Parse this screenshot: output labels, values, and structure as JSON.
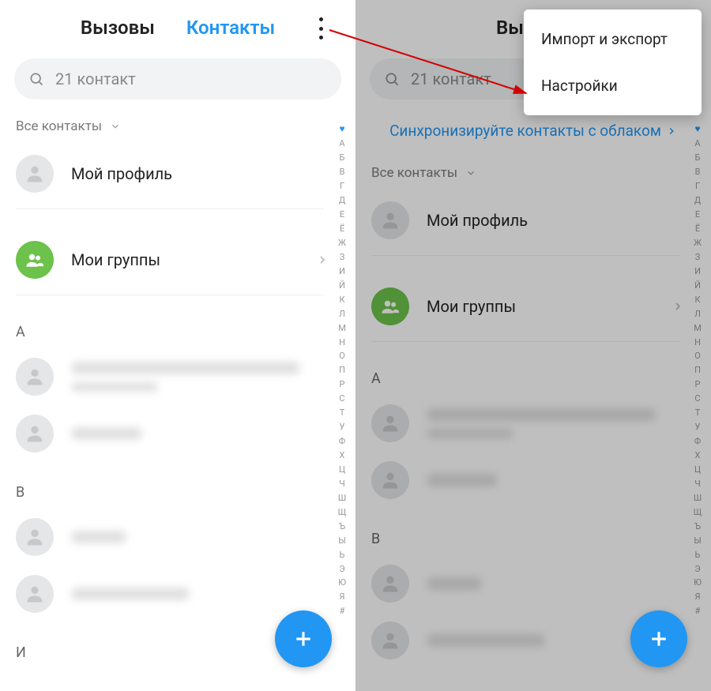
{
  "tabs": {
    "calls": "Вызовы",
    "contacts": "Контакты"
  },
  "search_placeholder": "21 контакт",
  "sync_banner": "Синхронизируйте контакты с облаком",
  "filter_label": "Все контакты",
  "my_profile": "Мой профиль",
  "my_groups": "Мои группы",
  "sections": {
    "a": "А",
    "v": "В",
    "i": "И"
  },
  "popup": {
    "import_export": "Импорт и экспорт",
    "settings": "Настройки"
  },
  "index_letters": [
    "А",
    "Б",
    "В",
    "Г",
    "Д",
    "Е",
    "Ё",
    "Ж",
    "З",
    "И",
    "Й",
    "К",
    "Л",
    "М",
    "Н",
    "О",
    "П",
    "Р",
    "С",
    "Т",
    "У",
    "Ф",
    "Х",
    "Ц",
    "Ч",
    "Ш",
    "Щ",
    "Ъ",
    "Ы",
    "Ь",
    "Э",
    "Ю",
    "Я",
    "#"
  ],
  "colors": {
    "accent": "#2196f3",
    "fab": "#2196f3",
    "group_avatar": "#6cc24a"
  }
}
